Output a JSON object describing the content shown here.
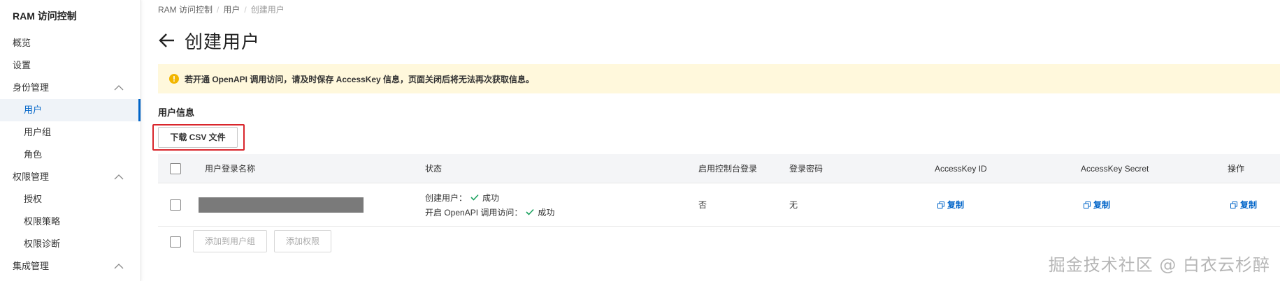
{
  "sidebar": {
    "title": "RAM 访问控制",
    "items": [
      {
        "label": "概览"
      },
      {
        "label": "设置"
      },
      {
        "label": "身份管理"
      },
      {
        "label": "用户"
      },
      {
        "label": "用户组"
      },
      {
        "label": "角色"
      },
      {
        "label": "权限管理"
      },
      {
        "label": "授权"
      },
      {
        "label": "权限策略"
      },
      {
        "label": "权限诊断"
      },
      {
        "label": "集成管理"
      }
    ]
  },
  "breadcrumb": [
    "RAM 访问控制",
    "用户",
    "创建用户"
  ],
  "page": {
    "title": "创建用户",
    "alert": "若开通 OpenAPI 调用访问，请及时保存 AccessKey 信息，页面关闭后将无法再次获取信息。",
    "section_title": "用户信息",
    "download_button": "下载 CSV 文件"
  },
  "table": {
    "headers": [
      "用户登录名称",
      "状态",
      "启用控制台登录",
      "登录密码",
      "AccessKey ID",
      "AccessKey Secret",
      "操作"
    ],
    "rows": [
      {
        "status_create": "创建用户：",
        "status_create_value": "成功",
        "status_openapi": "开启 OpenAPI 调用访问：",
        "status_openapi_value": "成功",
        "console_login": "否",
        "password": "无",
        "accesskey_id_action": "复制",
        "accesskey_secret_action": "复制",
        "op_action": "复制"
      }
    ]
  },
  "footer": {
    "add_to_group": "添加到用户组",
    "add_permission": "添加权限"
  },
  "watermark": "掘金技术社区 @ 白衣云杉醉",
  "colors": {
    "accent": "#0064c8",
    "warning_bg": "#fff8dc",
    "highlight": "#d9262c",
    "success": "#1aa15e"
  }
}
